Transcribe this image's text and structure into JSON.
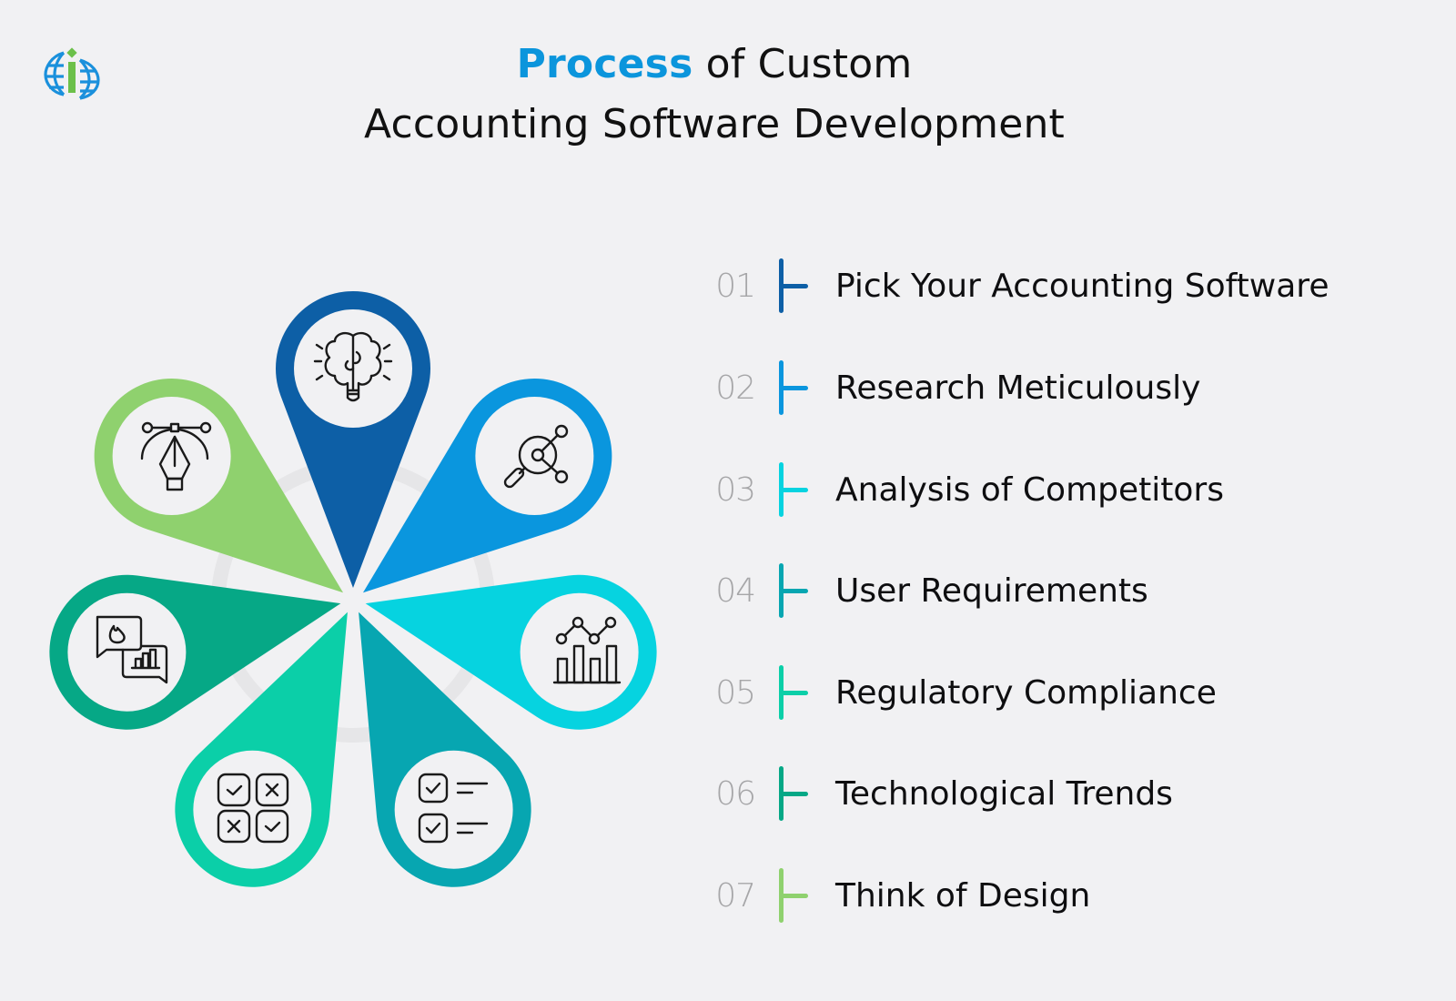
{
  "brand": {
    "logo_icon": "globe-i-logo-icon",
    "logo_colors": {
      "globe": "#1a90dc",
      "letter": "#6cc04a"
    }
  },
  "header": {
    "title_accent": "Process",
    "title_rest_line1": " of Custom",
    "title_line2": "Accounting Software Development",
    "accent_color": "#0b95dc"
  },
  "petals": [
    {
      "id": "01",
      "color": "#0d5fa6",
      "icon": "brain-bulb-icon"
    },
    {
      "id": "02",
      "color": "#0a96de",
      "icon": "magnifier-network-icon"
    },
    {
      "id": "03",
      "color": "#06d3e0",
      "icon": "line-bar-chart-icon"
    },
    {
      "id": "04",
      "color": "#07a6b1",
      "icon": "checklist-icon"
    },
    {
      "id": "05",
      "color": "#0bcfa8",
      "icon": "check-cross-grid-icon"
    },
    {
      "id": "06",
      "color": "#06a886",
      "icon": "chat-fire-chart-icon"
    },
    {
      "id": "07",
      "color": "#8fd16e",
      "icon": "pen-tool-bezier-icon"
    }
  ],
  "steps": [
    {
      "number": "01",
      "label": "Pick Your Accounting Software",
      "color": "#0d5fa6"
    },
    {
      "number": "02",
      "label": "Research Meticulously",
      "color": "#0a96de"
    },
    {
      "number": "03",
      "label": "Analysis of Competitors",
      "color": "#06d3e0"
    },
    {
      "number": "04",
      "label": "User Requirements",
      "color": "#07a6b1"
    },
    {
      "number": "05",
      "label": "Regulatory Compliance",
      "color": "#0bcfa8"
    },
    {
      "number": "06",
      "label": "Technological Trends",
      "color": "#06a886"
    },
    {
      "number": "07",
      "label": "Think of Design",
      "color": "#8fd16e"
    }
  ]
}
